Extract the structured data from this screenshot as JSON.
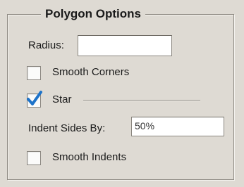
{
  "group": {
    "title": "Polygon Options"
  },
  "radius": {
    "label": "Radius:",
    "value": ""
  },
  "smooth_corners": {
    "label": "Smooth Corners",
    "checked": false
  },
  "star": {
    "label": "Star",
    "checked": true
  },
  "indent": {
    "label": "Indent Sides By:",
    "value": "50%"
  },
  "smooth_indents": {
    "label": "Smooth Indents",
    "checked": false
  },
  "colors": {
    "checkmark": "#1e73c9",
    "background": "#dedad3"
  }
}
